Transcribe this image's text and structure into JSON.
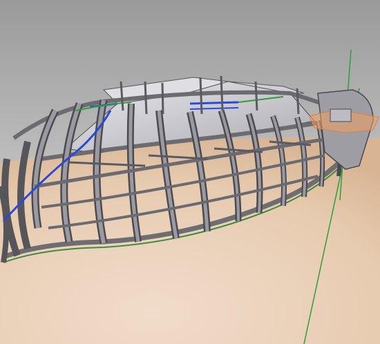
{
  "viewport": {
    "title": "",
    "colors": {
      "sky_top": "#9a9a9a",
      "sky_bottom": "#e2e2e2",
      "ground": "#e9cfb5",
      "ground_far": "#d9b898",
      "frame_fill": "#8e8e93",
      "frame_stroke": "#3d3d42",
      "skin_fill": "#c9c9cf",
      "axis_green": "#2e9e3a",
      "selection_orange": "#f0a060",
      "highlight_blue": "#2a4bd8"
    }
  },
  "model": {
    "name": "boat-hull-frame-assembly",
    "frame_count": 12,
    "icons": [
      "axis-green-icon",
      "selection-plane-icon"
    ]
  }
}
